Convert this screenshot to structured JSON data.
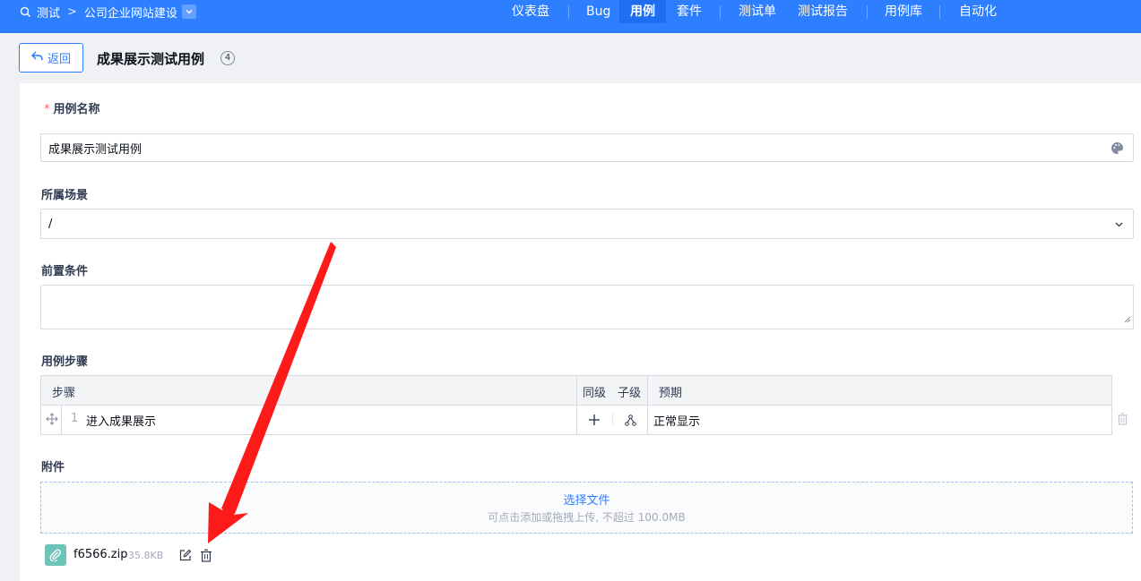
{
  "topbar": {
    "product": "测试",
    "project": "公司企业网站建设",
    "nav": [
      {
        "label": "仪表盘"
      },
      {
        "label": "Bug"
      },
      {
        "label": "用例",
        "active": true
      },
      {
        "label": "套件"
      },
      {
        "label": "测试单"
      },
      {
        "label": "测试报告"
      },
      {
        "label": "用例库"
      },
      {
        "label": "自动化"
      }
    ]
  },
  "header": {
    "back_label": "返回",
    "title": "成果展示测试用例",
    "count": "4"
  },
  "form": {
    "name_label": "用例名称",
    "name_value": "成果展示测试用例",
    "scene_label": "所属场景",
    "scene_value": "/",
    "precondition_label": "前置条件",
    "precondition_value": "",
    "steps_label": "用例步骤",
    "steps_columns": {
      "step": "步骤",
      "same_level": "同级",
      "child_level": "子级",
      "expect": "预期"
    },
    "steps": [
      {
        "index": "1",
        "step": "进入成果展示",
        "expect": "正常显示"
      }
    ],
    "attachment_label": "附件",
    "upload_title": "选择文件",
    "upload_hint": "可点击添加或拖拽上传, 不超过 100.0MB",
    "files": [
      {
        "name": "f6566.zip",
        "size": "35.8KB"
      }
    ]
  },
  "colors": {
    "brand": "#2e7fff",
    "annotation_arrow": "#ff1a1a"
  },
  "icons": [
    "search-icon",
    "chevron-down-icon",
    "back-arrow-icon",
    "palette-icon",
    "move-icon",
    "plus-icon",
    "hierarchy-icon",
    "trash-icon",
    "paperclip-icon",
    "edit-icon"
  ]
}
